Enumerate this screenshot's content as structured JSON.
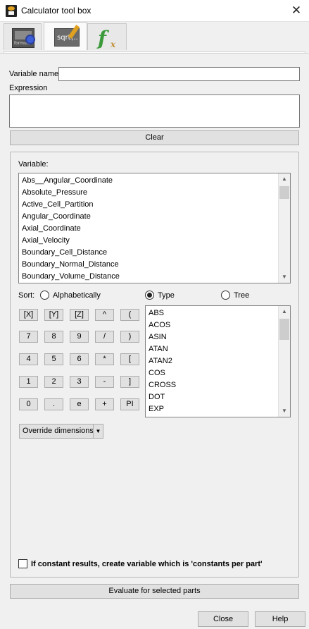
{
  "window": {
    "title": "Calculator tool box",
    "close_glyph": "✕"
  },
  "tabs": [
    {
      "name": "formula",
      "icon": "formula-calculator-icon"
    },
    {
      "name": "sqrt",
      "icon": "sqrt-editor-icon",
      "text": "sqrt(.."
    },
    {
      "name": "function",
      "icon": "function-fx-icon",
      "text": "f"
    }
  ],
  "form": {
    "variable_name_label": "Variable name",
    "variable_name_value": "",
    "expression_label": "Expression",
    "expression_value": "",
    "clear_label": "Clear"
  },
  "variable_section": {
    "label": "Variable:",
    "items": [
      "Abs__Angular_Coordinate",
      "Absolute_Pressure",
      "Active_Cell_Partition",
      "Angular_Coordinate",
      "Axial_Coordinate",
      "Axial_Velocity",
      "Boundary_Cell_Distance",
      "Boundary_Normal_Distance",
      "Boundary_Volume_Distance"
    ]
  },
  "sort": {
    "label": "Sort:",
    "options": [
      "Alphabetically",
      "Type",
      "Tree"
    ],
    "selected": "Type"
  },
  "keypad": {
    "rows": [
      [
        "[X]",
        "[Y]",
        "[Z]",
        "^",
        "("
      ],
      [
        "7",
        "8",
        "9",
        "/",
        ")"
      ],
      [
        "4",
        "5",
        "6",
        "*",
        "["
      ],
      [
        "1",
        "2",
        "3",
        "-",
        "]"
      ],
      [
        "0",
        ".",
        "e",
        "+",
        "PI"
      ]
    ]
  },
  "functions": {
    "items": [
      "ABS",
      "ACOS",
      "ASIN",
      "ATAN",
      "ATAN2",
      "COS",
      "CROSS",
      "DOT",
      "EXP"
    ]
  },
  "override_dimensions": {
    "label": "Override dimensions",
    "arrow": "▼"
  },
  "constants_checkbox": {
    "label": "If constant results, create variable which is 'constants per part'",
    "checked": false
  },
  "evaluate_label": "Evaluate for selected parts",
  "footer": {
    "close_label": "Close",
    "help_label": "Help"
  },
  "scroll_arrows": {
    "up": "▲",
    "down": "▼"
  }
}
